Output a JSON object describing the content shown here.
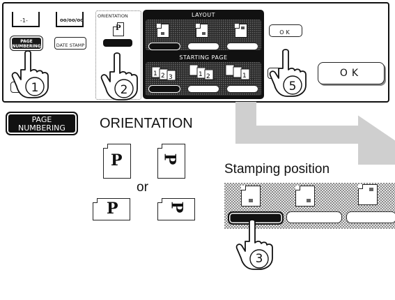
{
  "panel": {
    "page_numbering_icon_text": "-1-",
    "page_numbering_label": "PAGE NUMBERING",
    "date_stamp_icon_text": "oo/oo/oo",
    "date_stamp_label": "DATE STAMP",
    "orientation_title": "ORIENTATION",
    "orientation_glyph": "P",
    "layout_title": "LAYOUT",
    "starting_page_title": "STARTING PAGE",
    "ok_label": "OK",
    "step_1": "1",
    "step_2": "2",
    "step_5": "5"
  },
  "ok_large_label": "OK",
  "page_numbering_large_label": "PAGE NUMBERING",
  "orientation_heading": "ORIENTATION",
  "orientation_options": {
    "glyph": "P",
    "or_label": "or"
  },
  "stamping": {
    "heading": "Stamping position",
    "step_3": "3"
  },
  "colors": {
    "dark": "#111111",
    "arrow_gray": "#cfcfcf",
    "checker_a": "#9a9a9a",
    "checker_b": "#e8e8e8"
  }
}
